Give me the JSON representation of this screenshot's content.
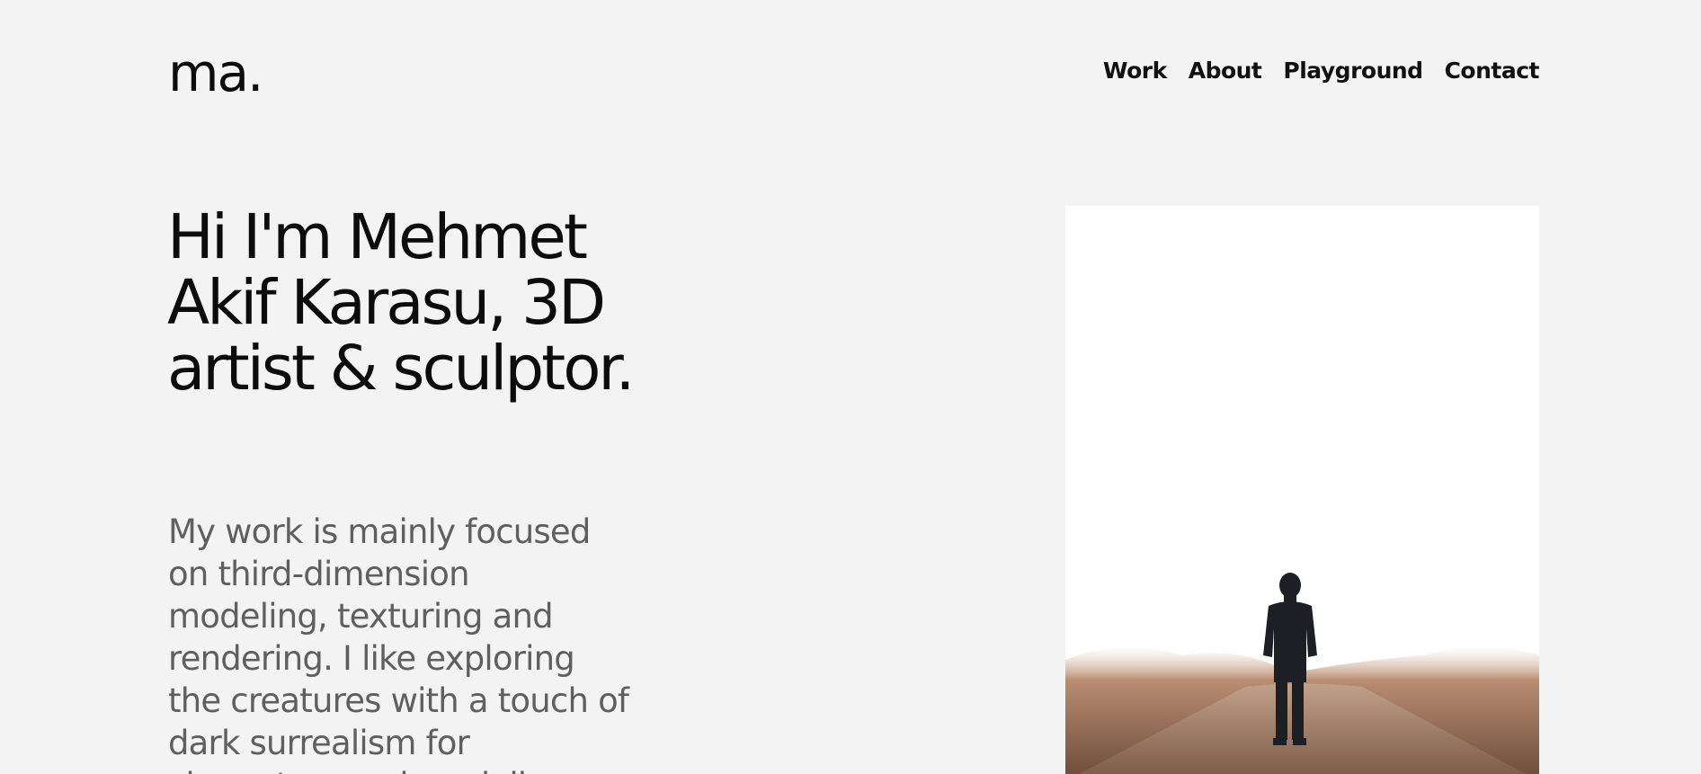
{
  "brand": {
    "logo": "ma."
  },
  "nav": {
    "items": [
      {
        "label": "Work"
      },
      {
        "label": "About"
      },
      {
        "label": "Playground"
      },
      {
        "label": "Contact"
      }
    ]
  },
  "hero": {
    "title": "Hi I'm Mehmet Akif Karasu, 3D artist & sculptor.",
    "description": "My work is mainly focused on third-dimension modeling, texturing and rendering. I like exploring the creatures with a touch of dark surrealism for characters and modeling.",
    "image_icon": "person-walking-on-road-photo"
  },
  "colors": {
    "background": "#f3f3f3",
    "text": "#0c0c0c",
    "muted_text": "#5f5f5f"
  }
}
